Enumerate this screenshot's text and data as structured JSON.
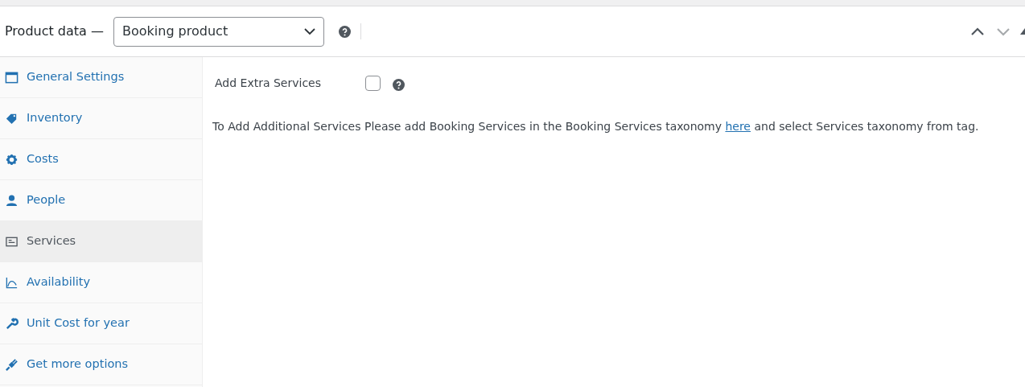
{
  "header": {
    "title": "Product data —",
    "product_type": "Booking product"
  },
  "tabs": [
    {
      "label": "General Settings",
      "selected": false
    },
    {
      "label": "Inventory",
      "selected": false
    },
    {
      "label": "Costs",
      "selected": false
    },
    {
      "label": "People",
      "selected": false
    },
    {
      "label": "Services",
      "selected": true
    },
    {
      "label": "Availability",
      "selected": false
    },
    {
      "label": "Unit Cost for year",
      "selected": false
    },
    {
      "label": "Get more options",
      "selected": false
    }
  ],
  "panel": {
    "field_label": "Add Extra Services",
    "checked": false,
    "note_before": "To Add Additional Services Please add Booking Services in the Booking Services taxonomy",
    "note_link": "here",
    "note_after": "and select Services taxonomy from tag."
  }
}
